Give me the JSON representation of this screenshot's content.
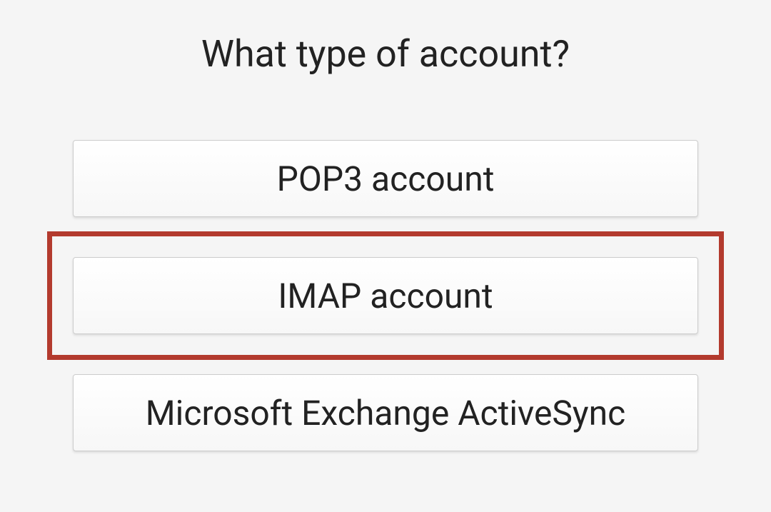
{
  "title": "What type of account?",
  "options": [
    {
      "label": "POP3 account",
      "selected": false
    },
    {
      "label": "IMAP account",
      "selected": true
    },
    {
      "label": "Microsoft Exchange ActiveSync",
      "selected": false
    }
  ],
  "colors": {
    "highlight": "#b33a2e"
  }
}
